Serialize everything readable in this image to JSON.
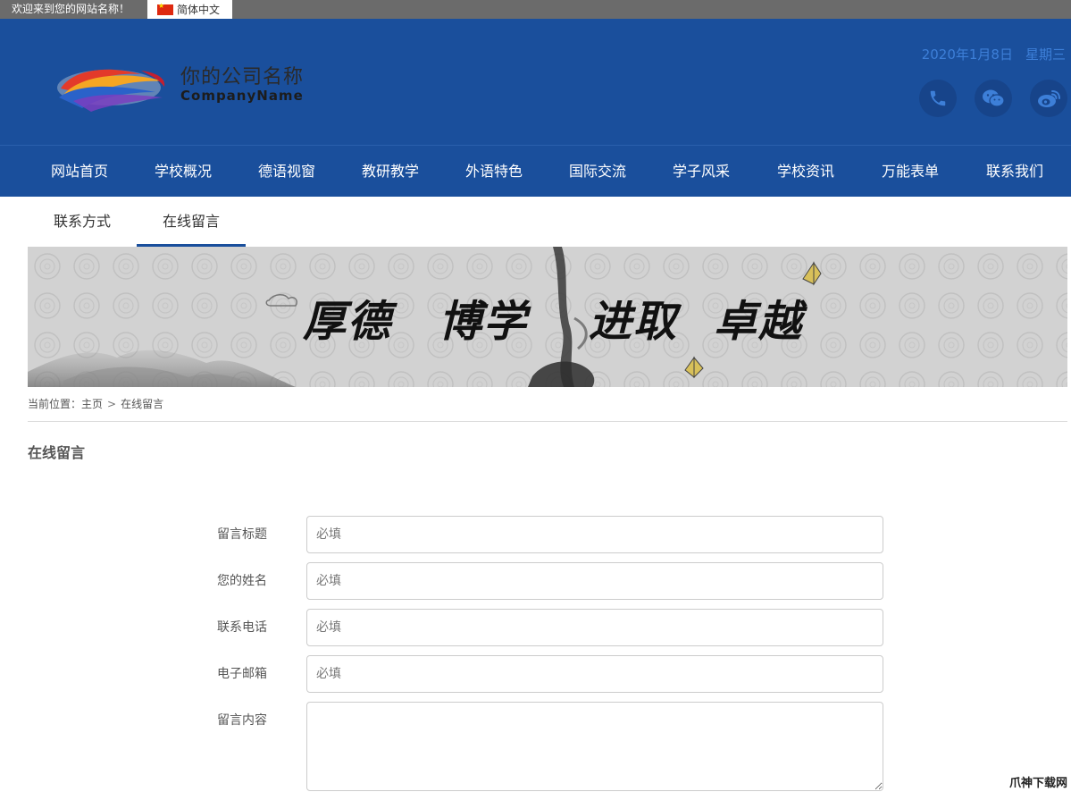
{
  "topbar": {
    "welcome": "欢迎来到您的网站名称！",
    "language": "简体中文",
    "flag_icon": "china-flag-icon"
  },
  "header": {
    "company_name_cn": "你的公司名称",
    "company_name_en": "CompanyName",
    "date": "2020年1月8日",
    "weekday": "星期三",
    "social_icons": [
      "phone-icon",
      "wechat-icon",
      "weibo-icon"
    ],
    "colors": {
      "primary": "#1a4f9c",
      "date_text": "#3d7fd8",
      "icon_circle": "#17448a"
    }
  },
  "nav": {
    "items": [
      "网站首页",
      "学校概况",
      "德语视窗",
      "教研教学",
      "外语特色",
      "国际交流",
      "学子风采",
      "学校资讯",
      "万能表单",
      "联系我们"
    ]
  },
  "subtabs": {
    "items": [
      "联系方式",
      "在线留言"
    ],
    "active": "在线留言"
  },
  "banner": {
    "words": [
      "厚德",
      "博学",
      "进取",
      "卓越"
    ]
  },
  "breadcrumb": {
    "prefix": "当前位置：",
    "home": "主页",
    "separator": ">",
    "current": "在线留言"
  },
  "page": {
    "title": "在线留言"
  },
  "form": {
    "fields": [
      {
        "label": "留言标题",
        "placeholder": "必填"
      },
      {
        "label": "您的姓名",
        "placeholder": "必填"
      },
      {
        "label": "联系电话",
        "placeholder": "必填"
      },
      {
        "label": "电子邮箱",
        "placeholder": "必填"
      }
    ],
    "content_label": "留言内容",
    "content_value": ""
  },
  "watermark": "爪神下载网"
}
